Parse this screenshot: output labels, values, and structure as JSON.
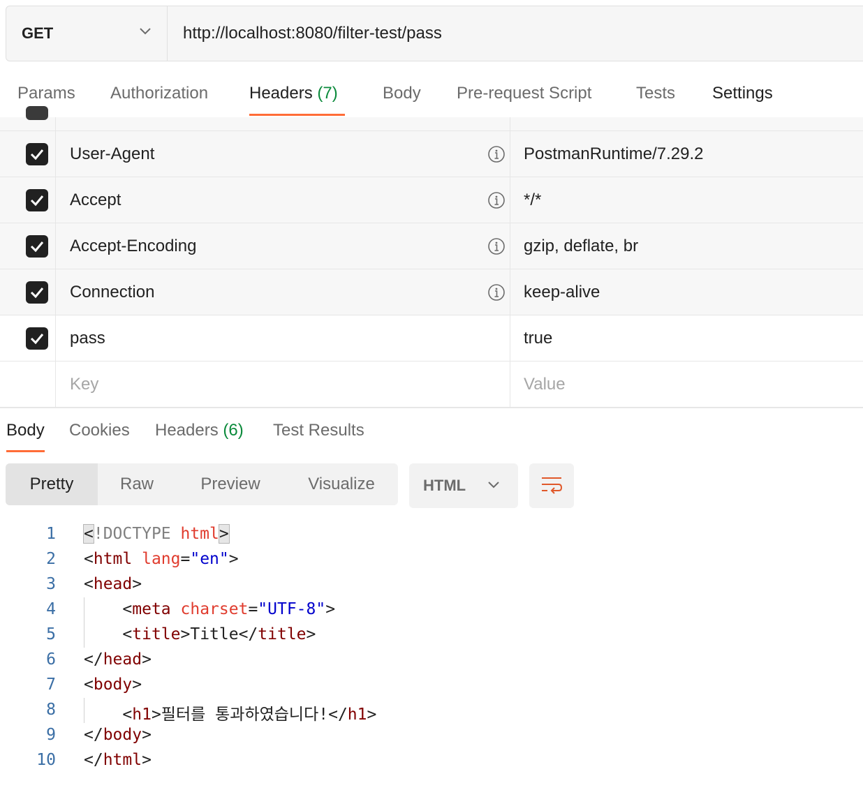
{
  "request": {
    "method": "GET",
    "url": "http://localhost:8080/filter-test/pass"
  },
  "request_tabs": [
    {
      "label": "Params",
      "count": ""
    },
    {
      "label": "Authorization",
      "count": ""
    },
    {
      "label": "Headers",
      "count": "(7)"
    },
    {
      "label": "Body",
      "count": ""
    },
    {
      "label": "Pre-request Script",
      "count": ""
    },
    {
      "label": "Tests",
      "count": ""
    },
    {
      "label": "Settings",
      "count": ""
    }
  ],
  "headers": [
    {
      "key": "User-Agent",
      "value": "PostmanRuntime/7.29.2",
      "checked": true,
      "auto": true
    },
    {
      "key": "Accept",
      "value": "*/*",
      "checked": true,
      "auto": true
    },
    {
      "key": "Accept-Encoding",
      "value": "gzip, deflate, br",
      "checked": true,
      "auto": true
    },
    {
      "key": "Connection",
      "value": "keep-alive",
      "checked": true,
      "auto": true
    },
    {
      "key": "pass",
      "value": "true",
      "checked": true,
      "auto": false
    }
  ],
  "new_header": {
    "key_placeholder": "Key",
    "value_placeholder": "Value"
  },
  "response_tabs": [
    {
      "label": "Body",
      "count": ""
    },
    {
      "label": "Cookies",
      "count": ""
    },
    {
      "label": "Headers",
      "count": "(6)"
    },
    {
      "label": "Test Results",
      "count": ""
    }
  ],
  "view_modes": [
    "Pretty",
    "Raw",
    "Preview",
    "Visualize"
  ],
  "language": "HTML",
  "code_lines": [
    {
      "n": "1",
      "parts": [
        [
          "b",
          "<"
        ],
        [
          "d",
          "!DOCTYPE "
        ],
        [
          "a",
          "html"
        ],
        [
          "b",
          ">"
        ]
      ]
    },
    {
      "n": "2",
      "parts": [
        [
          "p",
          "<"
        ],
        [
          "t",
          "html"
        ],
        [
          "p",
          " "
        ],
        [
          "a",
          "lang"
        ],
        [
          "p",
          "="
        ],
        [
          "s",
          "\"en\""
        ],
        [
          "p",
          ">"
        ]
      ]
    },
    {
      "n": "3",
      "parts": [
        [
          "p",
          "<"
        ],
        [
          "t",
          "head"
        ],
        [
          "p",
          ">"
        ]
      ]
    },
    {
      "n": "4",
      "parts": [
        [
          "p",
          "    <"
        ],
        [
          "t",
          "meta"
        ],
        [
          "p",
          " "
        ],
        [
          "a",
          "charset"
        ],
        [
          "p",
          "="
        ],
        [
          "s",
          "\"UTF-8\""
        ],
        [
          "p",
          ">"
        ]
      ]
    },
    {
      "n": "5",
      "parts": [
        [
          "p",
          "    <"
        ],
        [
          "t",
          "title"
        ],
        [
          "p",
          ">Title</"
        ],
        [
          "t",
          "title"
        ],
        [
          "p",
          ">"
        ]
      ]
    },
    {
      "n": "6",
      "parts": [
        [
          "p",
          "</"
        ],
        [
          "t",
          "head"
        ],
        [
          "p",
          ">"
        ]
      ]
    },
    {
      "n": "7",
      "parts": [
        [
          "p",
          "<"
        ],
        [
          "t",
          "body"
        ],
        [
          "p",
          ">"
        ]
      ]
    },
    {
      "n": "8",
      "parts": [
        [
          "p",
          "    <"
        ],
        [
          "t",
          "h1"
        ],
        [
          "p",
          ">필터를 통과하였습니다!</"
        ],
        [
          "t",
          "h1"
        ],
        [
          "p",
          ">"
        ]
      ]
    },
    {
      "n": "9",
      "parts": [
        [
          "p",
          "</"
        ],
        [
          "t",
          "body"
        ],
        [
          "p",
          ">"
        ]
      ]
    },
    {
      "n": "10",
      "parts": [
        [
          "p",
          "</"
        ],
        [
          "t",
          "html"
        ],
        [
          "p",
          ">"
        ]
      ]
    }
  ],
  "colors": {
    "accent": "#ff6c37",
    "count_green": "#0b8a3b",
    "line_number": "#3a6ea5"
  }
}
